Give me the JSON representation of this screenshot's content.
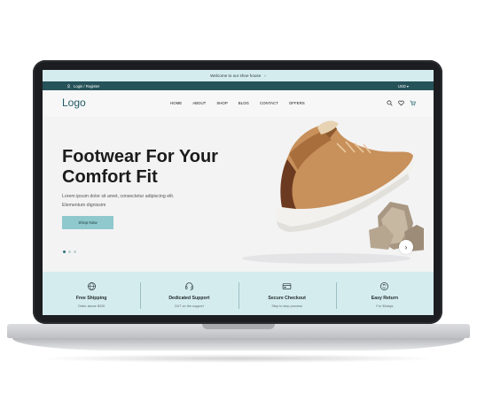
{
  "announcement": {
    "text": "Welcome to our shoe house",
    "arrow": "›"
  },
  "topbar": {
    "login_label": "Login / Register",
    "currency": "USD ▾"
  },
  "nav": {
    "logo": "Logo",
    "menu": [
      "HOME",
      "ABOUT",
      "SHOP",
      "BLOG",
      "CONTACT",
      "OFFERS"
    ]
  },
  "hero": {
    "title_line1": "Footwear For Your",
    "title_line2": "Comfort Fit",
    "subtitle_line1": "Lorem ipsum dolor sit amet, consectetur adipiscing elit.",
    "subtitle_line2": "Elementum dignissim",
    "button": "Shop Now",
    "next_arrow": "›",
    "slide_count": 3,
    "active_slide": 1
  },
  "features": [
    {
      "title": "Free Shipping",
      "sub": "Order above $200",
      "icon": "globe-shipping-icon"
    },
    {
      "title": "Dedicated Support",
      "sub": "24/7 on the support",
      "icon": "headset-icon"
    },
    {
      "title": "Secure Checkout",
      "sub": "Step to step process",
      "icon": "credit-card-icon"
    },
    {
      "title": "Easy Return",
      "sub": "For 30days",
      "icon": "return-icon"
    }
  ],
  "colors": {
    "accent_light": "#d5ecef",
    "accent_dark": "#26525a",
    "button": "#8fc9cd",
    "logo": "#235a64"
  }
}
